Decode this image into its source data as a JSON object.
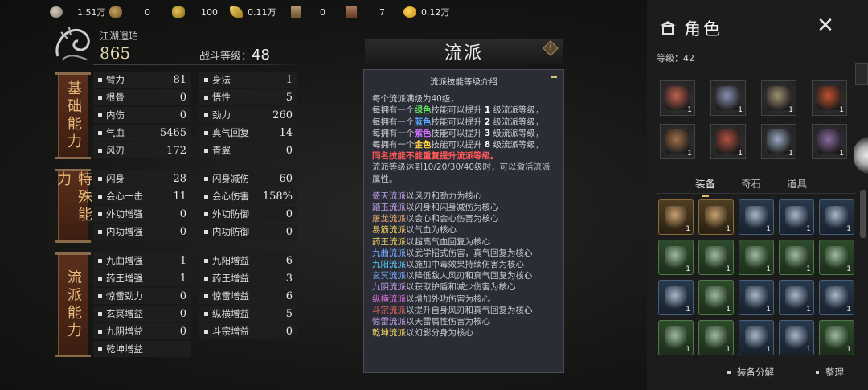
{
  "currencies": [
    {
      "icon": "silver-coin-icon",
      "value": "1.51万"
    },
    {
      "icon": "ingot-icon",
      "value": "0"
    },
    {
      "icon": "gold-bar-icon",
      "value": "100"
    },
    {
      "icon": "gold-leaf-icon",
      "value": "0.11万"
    },
    {
      "icon": "scroll-icon",
      "value": "0"
    },
    {
      "icon": "book-icon",
      "value": "7"
    },
    {
      "icon": "gold-coin-icon",
      "value": "0.12万"
    }
  ],
  "character": {
    "name": "江湖遗珀",
    "power": "865",
    "combat_level_label": "战斗等级：",
    "combat_level": "48"
  },
  "groups": {
    "basic": "基础能力",
    "special": "特殊能力",
    "school": "流派能力"
  },
  "stats_basic": [
    {
      "label": "臂力",
      "value": "81"
    },
    {
      "label": "身法",
      "value": "1"
    },
    {
      "label": "根骨",
      "value": "0"
    },
    {
      "label": "悟性",
      "value": "5"
    },
    {
      "label": "内伤",
      "value": "0"
    },
    {
      "label": "劲力",
      "value": "260"
    },
    {
      "label": "气血",
      "value": "5465"
    },
    {
      "label": "真气回复",
      "value": "14"
    },
    {
      "label": "风刃",
      "value": "172"
    },
    {
      "label": "青翼",
      "value": "0"
    }
  ],
  "stats_special": [
    {
      "label": "闪身",
      "value": "28"
    },
    {
      "label": "闪身减伤",
      "value": "60"
    },
    {
      "label": "会心一击",
      "value": "11"
    },
    {
      "label": "会心伤害",
      "value": "158%"
    },
    {
      "label": "外功增强",
      "value": "0"
    },
    {
      "label": "外功防御",
      "value": "0"
    },
    {
      "label": "内功增强",
      "value": "0"
    },
    {
      "label": "内功防御",
      "value": "0"
    }
  ],
  "stats_school": [
    {
      "label": "九曲增强",
      "value": "1"
    },
    {
      "label": "九阳增益",
      "value": "6"
    },
    {
      "label": "药王增强",
      "value": "1"
    },
    {
      "label": "药王增益",
      "value": "3"
    },
    {
      "label": "惊雷劲力",
      "value": "0"
    },
    {
      "label": "惊雷增益",
      "value": "6"
    },
    {
      "label": "玄冥增益",
      "value": "0"
    },
    {
      "label": "纵横增益",
      "value": "5"
    },
    {
      "label": "九阴增益",
      "value": "0"
    },
    {
      "label": "斗宗增益",
      "value": "0"
    },
    {
      "label": "乾坤增益",
      "value": ""
    }
  ],
  "liupai": {
    "title": "流派",
    "info_icon": "!",
    "tooltip_title": "流派技能等级介绍",
    "intro": "每个流派满级为40级，",
    "lines": [
      {
        "pre": "每拥有一个",
        "color_word": "绿色",
        "color": "#5fe05f",
        "mid": "技能可以提升 ",
        "num": "1",
        "post": " 级流派等级，"
      },
      {
        "pre": "每拥有一个",
        "color_word": "蓝色",
        "color": "#5aa8ff",
        "mid": "技能可以提升 ",
        "num": "2",
        "post": " 级流派等级，"
      },
      {
        "pre": "每拥有一个",
        "color_word": "紫色",
        "color": "#d070ff",
        "mid": "技能可以提升 ",
        "num": "3",
        "post": " 级流派等级，"
      },
      {
        "pre": "每拥有一个",
        "color_word": "金色",
        "color": "#ffd040",
        "mid": "技能可以提升 ",
        "num": "8",
        "post": " 级流派等级，"
      }
    ],
    "warning": "同名技能不能重复提升流派等级。",
    "activate": "流派等级达到10/20/30/40级时，可以激活流派属性。",
    "schools": [
      {
        "name": "倚天流派",
        "desc": "以风刃和劲力为核心",
        "color": "#c0a0e8"
      },
      {
        "name": "踏玉流派",
        "desc": "以闪身和闪身减伤为核心",
        "color": "#c0a0e8"
      },
      {
        "name": "屠龙流派",
        "desc": "以会心和会心伤害为核心",
        "color": "#e8a870"
      },
      {
        "name": "易筋流派",
        "desc": "以气血为核心",
        "color": "#f0d060"
      },
      {
        "name": "药王流派",
        "desc": "以超高气血回复为核心",
        "color": "#f0d060"
      },
      {
        "name": "九曲流派",
        "desc": "以武学招式伤害，真气回复为核心",
        "color": "#7aa8ff"
      },
      {
        "name": "九阳流派",
        "desc": "以施加中毒效果持续伤害为核心",
        "color": "#5ad0ff"
      },
      {
        "name": "玄冥流派",
        "desc": "以降低敌人风刃和真气回复为核心",
        "color": "#7aa8ff"
      },
      {
        "name": "九阴流派",
        "desc": "以获取护盾和减少伤害为核心",
        "color": "#c0a0e8"
      },
      {
        "name": "纵横流派",
        "desc": "以增加外功伤害为核心",
        "color": "#e070e0"
      },
      {
        "name": "斗宗流派",
        "desc": "以提升自身风刃和真气回复为核心",
        "color": "#e06060"
      },
      {
        "name": "惊雷流派",
        "desc": "以天雷属性伤害为核心",
        "color": "#c0a0e8"
      },
      {
        "name": "乾坤流派",
        "desc": "以幻影分身为核心",
        "color": "#f0d060"
      }
    ]
  },
  "right": {
    "title": "角色",
    "close": "✕",
    "level": "等级：42",
    "equipped": [
      "1",
      "1",
      "1",
      "1",
      "1",
      "1",
      "1",
      "1"
    ],
    "tabs": [
      "装备",
      "奇石",
      "道具"
    ],
    "inventory": [
      {
        "quality": "gold",
        "count": "1"
      },
      {
        "quality": "gold",
        "count": "1"
      },
      {
        "quality": "blue",
        "count": "1"
      },
      {
        "quality": "blue",
        "count": "1"
      },
      {
        "quality": "blue",
        "count": "1"
      },
      {
        "quality": "green",
        "count": "1"
      },
      {
        "quality": "green",
        "count": "1"
      },
      {
        "quality": "green",
        "count": "1"
      },
      {
        "quality": "green",
        "count": "1"
      },
      {
        "quality": "green",
        "count": "1"
      },
      {
        "quality": "blue",
        "count": "1"
      },
      {
        "quality": "green",
        "count": "1"
      },
      {
        "quality": "blue",
        "count": "1"
      },
      {
        "quality": "blue",
        "count": "1"
      },
      {
        "quality": "blue",
        "count": "1"
      },
      {
        "quality": "green",
        "count": "1"
      },
      {
        "quality": "green",
        "count": "1"
      },
      {
        "quality": "blue",
        "count": "1"
      },
      {
        "quality": "blue",
        "count": "1"
      },
      {
        "quality": "green",
        "count": "1"
      }
    ],
    "btn_decompose": "装备分解",
    "btn_sort": "整理"
  }
}
